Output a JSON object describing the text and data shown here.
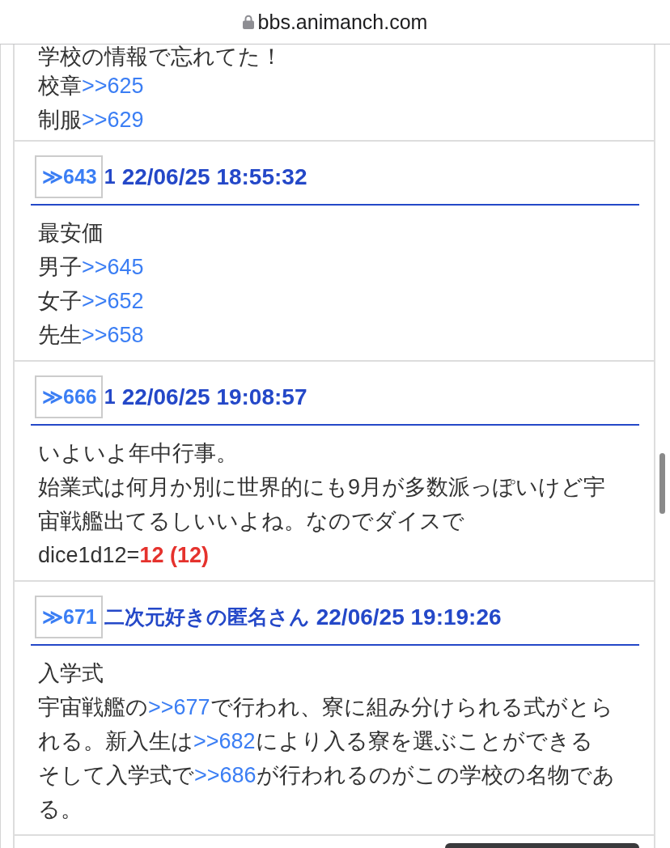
{
  "address_bar": {
    "url": "bbs.animanch.com"
  },
  "posts": [
    {
      "body": [
        [
          {
            "kind": "text",
            "text": "学校の情報で忘れてた！"
          }
        ],
        [
          {
            "kind": "text",
            "text": "校章"
          },
          {
            "kind": "anchor",
            "text": ">>625"
          }
        ],
        [
          {
            "kind": "text",
            "text": "制服"
          },
          {
            "kind": "anchor",
            "text": ">>629"
          }
        ]
      ]
    },
    {
      "header": {
        "number": "≫643",
        "name": "1",
        "date": "22/06/25 18:55:32"
      },
      "body": [
        [
          {
            "kind": "text",
            "text": "最安価"
          }
        ],
        [
          {
            "kind": "text",
            "text": "男子"
          },
          {
            "kind": "anchor",
            "text": ">>645"
          }
        ],
        [
          {
            "kind": "text",
            "text": "女子"
          },
          {
            "kind": "anchor",
            "text": ">>652"
          }
        ],
        [
          {
            "kind": "text",
            "text": "先生"
          },
          {
            "kind": "anchor",
            "text": ">>658"
          }
        ]
      ]
    },
    {
      "header": {
        "number": "≫666",
        "name": "1",
        "date": "22/06/25 19:08:57"
      },
      "body": [
        [
          {
            "kind": "text",
            "text": "いよいよ年中行事。"
          }
        ],
        [
          {
            "kind": "text",
            "text": "始業式は何月か別に世界的にも9月が多数派っぽいけど宇宙戦艦出てるしいいよね。なのでダイスで"
          }
        ],
        [
          {
            "kind": "text",
            "text": "dice1d12="
          },
          {
            "kind": "dice",
            "text": "12 (12)"
          }
        ]
      ]
    },
    {
      "header": {
        "number": "≫671",
        "name": "二次元好きの匿名さん",
        "date": "22/06/25 19:19:26"
      },
      "body": [
        [
          {
            "kind": "text",
            "text": "入学式"
          }
        ],
        [
          {
            "kind": "text",
            "text": "宇宙戦艦の"
          },
          {
            "kind": "anchor",
            "text": ">>677"
          },
          {
            "kind": "text",
            "text": "で行われ、寮に組み分けられる式がとられる。新入生は"
          },
          {
            "kind": "anchor",
            "text": ">>682"
          },
          {
            "kind": "text",
            "text": "により入る寮を選ぶことができる"
          }
        ],
        [
          {
            "kind": "text",
            "text": "そして入学式で"
          },
          {
            "kind": "anchor",
            "text": ">>686"
          },
          {
            "kind": "text",
            "text": "が行われるのがこの学校の名物である。"
          }
        ]
      ]
    }
  ]
}
